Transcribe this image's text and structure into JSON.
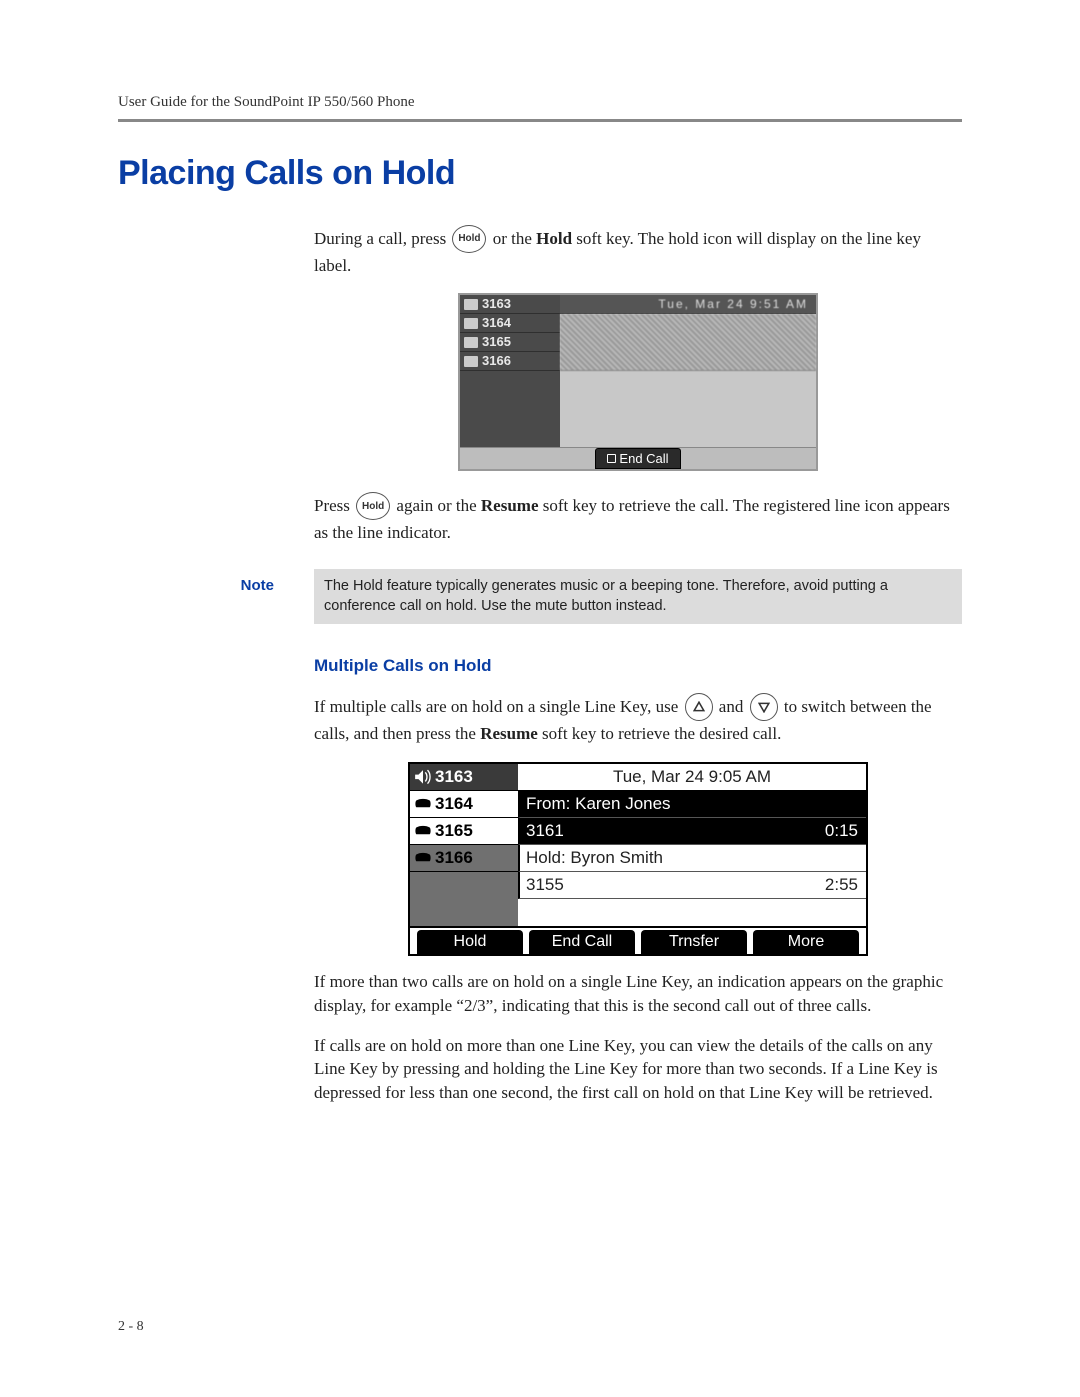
{
  "header": {
    "running": "User Guide for the SoundPoint IP 550/560 Phone"
  },
  "title": "Placing Calls on Hold",
  "p1": {
    "a": "During a call, press ",
    "b": " or the ",
    "hold": "Hold",
    "c": " soft key. The hold icon will display on the line key label."
  },
  "phone1": {
    "lines": [
      "3163",
      "3164",
      "3165",
      "3166"
    ],
    "titlebar": "Tue, Mar 24  9:51 AM",
    "endcall": "End Call"
  },
  "p2": {
    "a": "Press ",
    "b": " again or the ",
    "resume": "Resume",
    "c": " soft key to retrieve the call. The registered line icon appears as the line indicator."
  },
  "note": {
    "label": "Note",
    "text": "The Hold feature typically generates music or a beeping tone. Therefore, avoid putting a conference call on hold. Use the mute button instead."
  },
  "sub": "Multiple Calls on Hold",
  "p3": {
    "a": "If multiple calls are on hold on a single Line Key, use ",
    "b": " and ",
    "c": " to switch between the calls, and then press the ",
    "resume": "Resume",
    "d": " soft key to retrieve the desired call."
  },
  "phone2": {
    "lines": [
      "3163",
      "3164",
      "3165",
      "3166"
    ],
    "title": "Tue, Mar 24  9:05 AM",
    "r1": "From: Karen Jones",
    "r2n": "3161",
    "r2t": "0:15",
    "r3": "Hold: Byron Smith",
    "r4n": "3155",
    "r4t": "2:55",
    "sk": [
      "Hold",
      "End Call",
      "Trnsfer",
      "More"
    ]
  },
  "p4": "If more than two calls are on hold on a single Line Key, an indication appears on the graphic display, for example “2/3”, indicating that this is the second call out of three calls.",
  "p5": "If calls are on hold on more than one Line Key, you can view the details of the calls on any Line Key by pressing and holding the Line Key for more than two seconds. If a Line Key is depressed for less than one second, the first call on hold on that Line Key will be retrieved.",
  "keys": {
    "hold": "Hold"
  },
  "pagenum": "2 - 8"
}
